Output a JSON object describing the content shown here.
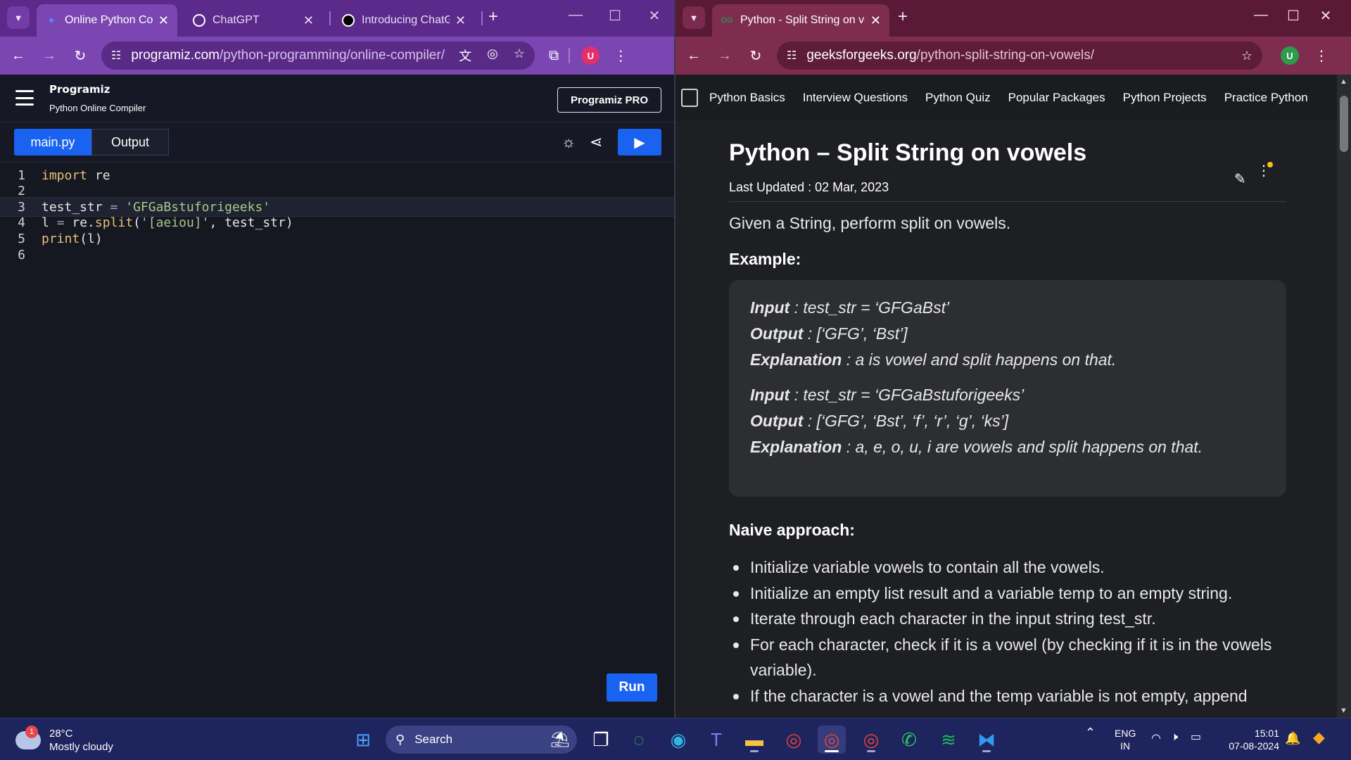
{
  "left_window": {
    "tabs": [
      {
        "title": "Online Python Compiler"
      },
      {
        "title": "ChatGPT"
      },
      {
        "title": "Introducing ChatGPT"
      }
    ],
    "address": {
      "host": "programiz.com",
      "path": "/python-programming/online-compiler/"
    },
    "avatar": "U",
    "programiz": {
      "logo": "Programiz",
      "subtitle": "Python Online Compiler",
      "pro_button": "Programiz PRO",
      "file_tab": "main.py",
      "output_tab": "Output",
      "run_label": "Run",
      "lines": [
        {
          "n": "1",
          "code": [
            {
              "t": "import",
              "c": "kw"
            },
            {
              "t": " re",
              "c": ""
            }
          ]
        },
        {
          "n": "2",
          "code": []
        },
        {
          "n": "3",
          "code": [
            {
              "t": "test_str ",
              "c": ""
            },
            {
              "t": "=",
              "c": "op"
            },
            {
              "t": " 'GFGaBstuforigeeks'",
              "c": "str"
            }
          ]
        },
        {
          "n": "4",
          "code": [
            {
              "t": "l ",
              "c": ""
            },
            {
              "t": "=",
              "c": "op"
            },
            {
              "t": " re.",
              "c": ""
            },
            {
              "t": "split",
              "c": "fn"
            },
            {
              "t": "(",
              "c": ""
            },
            {
              "t": "'[aeiou]'",
              "c": "str"
            },
            {
              "t": ", test_str)",
              "c": ""
            }
          ]
        },
        {
          "n": "5",
          "code": [
            {
              "t": "print",
              "c": "fn"
            },
            {
              "t": "(l)",
              "c": ""
            }
          ]
        },
        {
          "n": "6",
          "code": []
        }
      ]
    }
  },
  "right_window": {
    "tabs": [
      {
        "title": "Python - Split String on vowels"
      }
    ],
    "address": {
      "host": "geeksforgeeks.org",
      "path": "/python-split-string-on-vowels/"
    },
    "avatar": "U",
    "nav": [
      "Python Basics",
      "Interview Questions",
      "Python Quiz",
      "Popular Packages",
      "Python Projects",
      "Practice Python"
    ],
    "article": {
      "title": "Python – Split String on vowels",
      "updated": "Last Updated : 02 Mar, 2023",
      "intro": "Given a String, perform split on vowels.",
      "example_heading": "Example:",
      "examples": [
        {
          "label": "Input",
          "text": " : test_str = ‘GFGaBst’"
        },
        {
          "label": "Output",
          "text": " : [‘GFG’, ‘Bst’]"
        },
        {
          "label": "Explanation",
          "text": " : a is vowel and split happens on that."
        },
        {
          "label": "Input",
          "text": " : test_str = ‘GFGaBstuforigeeks’"
        },
        {
          "label": "Output",
          "text": " : [‘GFG’, ‘Bst’, ‘f’, ‘r’, ‘g’, ‘ks’]"
        },
        {
          "label": "Explanation",
          "text": " : a, e, o, u, i are vowels and split happens on that."
        }
      ],
      "naive_heading": "Naive approach:",
      "bullets": [
        "Initialize variable vowels to contain all the vowels.",
        "Initialize an empty list result and a variable temp to an empty string.",
        "Iterate through each character in the input string test_str.",
        "For each character, check if it is a vowel (by checking if it is in the vowels variable).",
        "If the character is a vowel and the temp variable is not empty, append"
      ]
    }
  },
  "taskbar": {
    "weather": {
      "temp": "28°C",
      "desc": "Mostly cloudy",
      "badge": "1"
    },
    "search": "Search",
    "lang": {
      "l1": "ENG",
      "l2": "IN"
    },
    "clock": {
      "time": "15:01",
      "date": "07-08-2024"
    }
  }
}
